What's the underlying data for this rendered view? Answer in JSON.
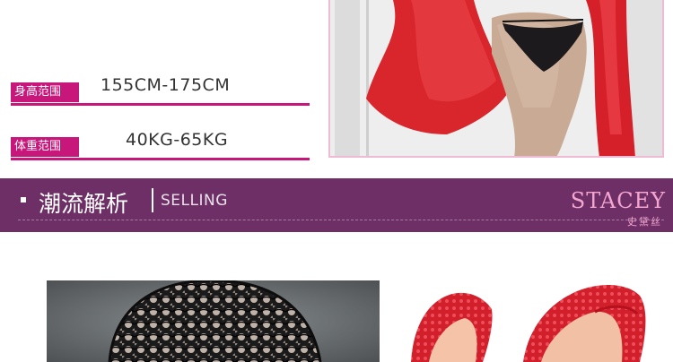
{
  "specs": {
    "height": {
      "label": "身高范围",
      "value": "155CM-175CM"
    },
    "weight": {
      "label": "体重范围",
      "value": "40KG-65KG"
    }
  },
  "banner": {
    "title_cn": "潮流解析",
    "title_en": "SELLING",
    "brand": "STACEY",
    "brand_cn": "史黛丝"
  },
  "colors": {
    "accent": "#c7177a",
    "banner_bg": "#6e2f66",
    "brand_pink": "#f3a6cf",
    "photo_border": "#f0b9d4"
  }
}
